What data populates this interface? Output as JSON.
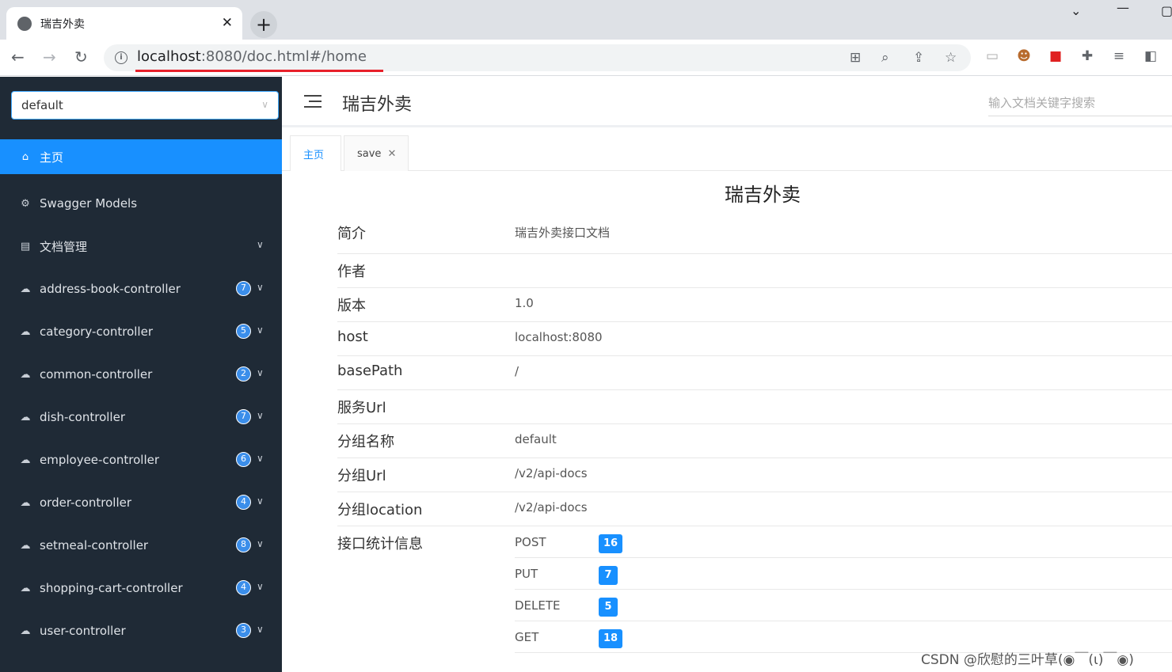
{
  "browser": {
    "tab_title": "瑞吉外卖",
    "tab_close": "✕",
    "new_tab": "+",
    "url_host": "localhost",
    "url_rest": ":8080/doc.html#/home"
  },
  "sidebar": {
    "group_select": "default",
    "items": [
      {
        "label": "主页",
        "icon": "home-icon",
        "badge": "",
        "expandable": false
      },
      {
        "label": "Swagger Models",
        "icon": "models-icon",
        "badge": "",
        "expandable": false
      },
      {
        "label": "文档管理",
        "icon": "document-icon",
        "badge": "",
        "expandable": true
      },
      {
        "label": "address-book-controller",
        "icon": "cloud-icon",
        "badge": "7",
        "expandable": true
      },
      {
        "label": "category-controller",
        "icon": "cloud-icon",
        "badge": "5",
        "expandable": true
      },
      {
        "label": "common-controller",
        "icon": "cloud-icon",
        "badge": "2",
        "expandable": true
      },
      {
        "label": "dish-controller",
        "icon": "cloud-icon",
        "badge": "7",
        "expandable": true
      },
      {
        "label": "employee-controller",
        "icon": "cloud-icon",
        "badge": "6",
        "expandable": true
      },
      {
        "label": "order-controller",
        "icon": "cloud-icon",
        "badge": "4",
        "expandable": true
      },
      {
        "label": "setmeal-controller",
        "icon": "cloud-icon",
        "badge": "8",
        "expandable": true
      },
      {
        "label": "shopping-cart-controller",
        "icon": "cloud-icon",
        "badge": "4",
        "expandable": true
      },
      {
        "label": "user-controller",
        "icon": "cloud-icon",
        "badge": "3",
        "expandable": true
      }
    ]
  },
  "header": {
    "title": "瑞吉外卖",
    "search_placeholder": "输入文档关键字搜索"
  },
  "tabs": [
    {
      "label": "主页",
      "closable": false
    },
    {
      "label": "save",
      "closable": true
    }
  ],
  "doc": {
    "title": "瑞吉外卖",
    "rows": [
      {
        "key": "简介",
        "value": "瑞吉外卖接口文档"
      },
      {
        "key": "作者",
        "value": ""
      },
      {
        "key": "版本",
        "value": "1.0"
      },
      {
        "key": "host",
        "value": "localhost:8080"
      },
      {
        "key": "basePath",
        "value": "/"
      },
      {
        "key": "服务Url",
        "value": ""
      },
      {
        "key": "分组名称",
        "value": "default"
      },
      {
        "key": "分组Url",
        "value": "/v2/api-docs"
      },
      {
        "key": "分组location",
        "value": "/v2/api-docs"
      }
    ],
    "stats_label": "接口统计信息",
    "stats": [
      {
        "method": "POST",
        "count": "16"
      },
      {
        "method": "PUT",
        "count": "7"
      },
      {
        "method": "DELETE",
        "count": "5"
      },
      {
        "method": "GET",
        "count": "18"
      }
    ]
  },
  "watermark": "CSDN @欣慰的三叶草(◉￣(ι)￣◉)",
  "colors": {
    "accent": "#1890ff",
    "sidebar": "#1f2a36",
    "badge": "#3b8eea"
  }
}
